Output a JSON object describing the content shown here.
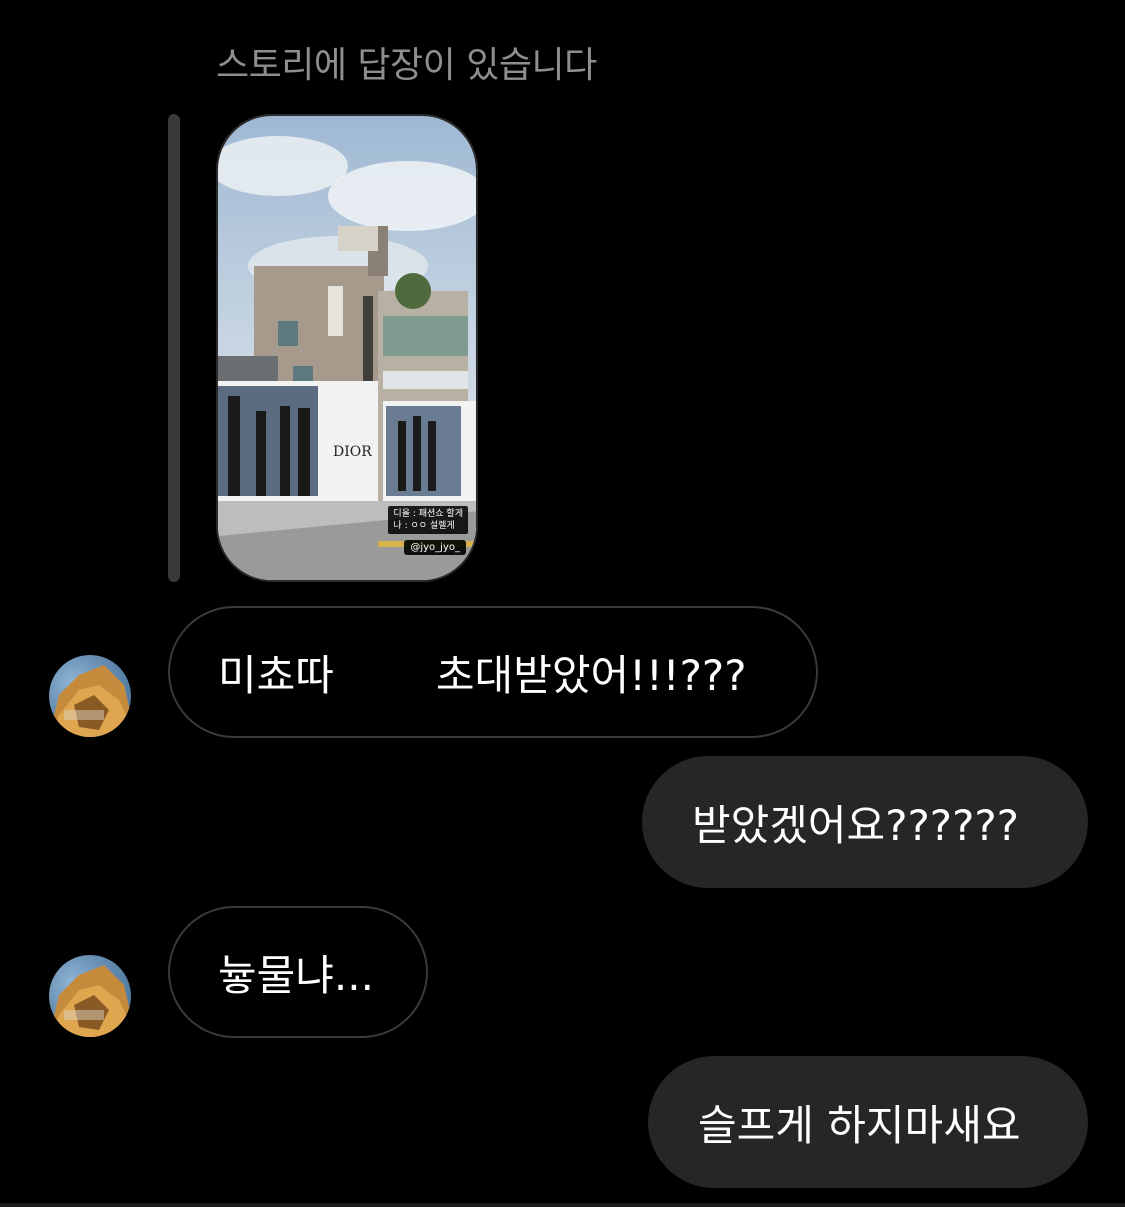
{
  "header": {
    "story_reply_label": "스토리에 답장이 있습니다"
  },
  "story": {
    "caption_line1": "디올 : 패션쇼 할게",
    "caption_line2": "나 : ㅇㅇ 설렐게",
    "handle": "@jyo_jyo_",
    "billboard_brand": "DIOR"
  },
  "messages": [
    {
      "direction": "incoming",
      "text_before": "미쵸따",
      "text_after": "초대받았어!!!???",
      "censored": true
    },
    {
      "direction": "outgoing",
      "text": "받았겠어요??????"
    },
    {
      "direction": "incoming",
      "text": "늏물냐..."
    },
    {
      "direction": "outgoing",
      "text": "슬프게 하지마새요"
    }
  ],
  "colors": {
    "background": "#000000",
    "incoming_border": "#3a3a3a",
    "outgoing_bubble": "#262626",
    "secondary_text": "#8e8e8e"
  }
}
